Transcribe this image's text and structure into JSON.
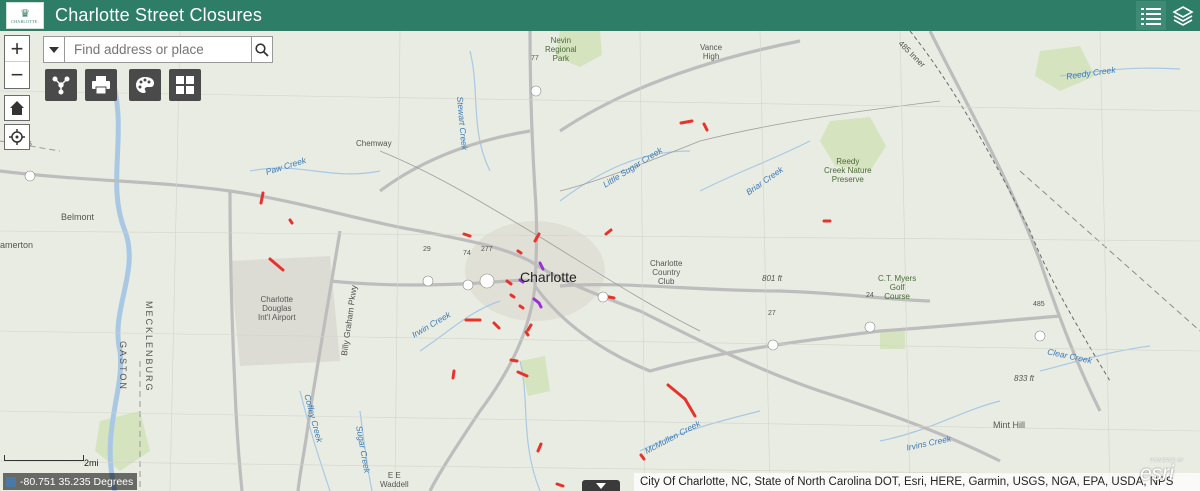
{
  "app": {
    "title": "Charlotte Street Closures",
    "logo_text": "CHARLOTTE."
  },
  "header_buttons": [
    {
      "name": "legend",
      "icon": "legend-list-icon"
    },
    {
      "name": "layers",
      "icon": "layers-stack-icon"
    }
  ],
  "search": {
    "placeholder": "Find address or place",
    "value": ""
  },
  "map_controls": {
    "zoom_in": "+",
    "zoom_out": "−",
    "home_icon": "home-icon",
    "locate_icon": "locate-icon"
  },
  "tools": [
    {
      "name": "share",
      "icon": "share-icon"
    },
    {
      "name": "print",
      "icon": "printer-icon"
    },
    {
      "name": "basemap",
      "icon": "palette-icon"
    },
    {
      "name": "basemap-gallery",
      "icon": "grid-icon"
    }
  ],
  "map_labels": {
    "nevin_park": "Nevin\nRegional\nPark",
    "vance_high": "Vance\nHigh",
    "chemway": "Chemway",
    "paw_creek": "Paw Creek",
    "belmont": "Belmont",
    "amerton": "amerton",
    "stewart_creek": "Stewart Creek",
    "little_sugar_creek": "Little Sugar Creek",
    "briar_creek": "Briar Creek",
    "reedy_preserve": "Reedy\nCreek Nature\nPreserve",
    "reedy_creek": "Reedy Creek",
    "charlotte": "Charlotte",
    "country_club": "Charlotte\nCountry\nClub",
    "elev_801": "801 ft",
    "ct_myers": "C.T. Myers\nGolf\nCourse",
    "airport": "Charlotte\nDouglas\nInt'l Airport",
    "billy_graham": "Billy Graham Pkwy",
    "irwin_creek": "Irwin Creek",
    "clear_creek": "Clear Creek",
    "elev_833": "833 ft",
    "gaston": "GASTON",
    "mecklenburg": "MECKLENBURG",
    "coffey_creek": "Coffey Creek",
    "sugar_creek": "Sugar Creek",
    "ee_waddell": "E E\nWaddell",
    "mcmullen_creek": "McMullen Creek",
    "irvins_creek": "Irvins Creek",
    "mint_hill": "Mint Hill",
    "inner_485": "485 Inner",
    "shield_77": "77",
    "shield_277": "277",
    "shield_74": "74",
    "shield_29": "29",
    "shield_27": "27",
    "shield_24": "24",
    "shield_85": "85",
    "shield_485": "485"
  },
  "scale": {
    "label": "2mi"
  },
  "coords": {
    "text": "-80.751 35.235 Degrees"
  },
  "attribution": "City Of Charlotte, NC, State of North Carolina DOT, Esri, HERE, Garmin, USGS, NGA, EPA, USDA, NPS",
  "esri": {
    "powered": "POWERED BY",
    "brand": "esri"
  },
  "colors": {
    "header": "#2e7d67",
    "closure": "#e8322c",
    "closure_purple": "#9b30d9",
    "map_bg": "#e9ece2",
    "water": "#a9c8e4",
    "park": "#cfe2b3"
  }
}
